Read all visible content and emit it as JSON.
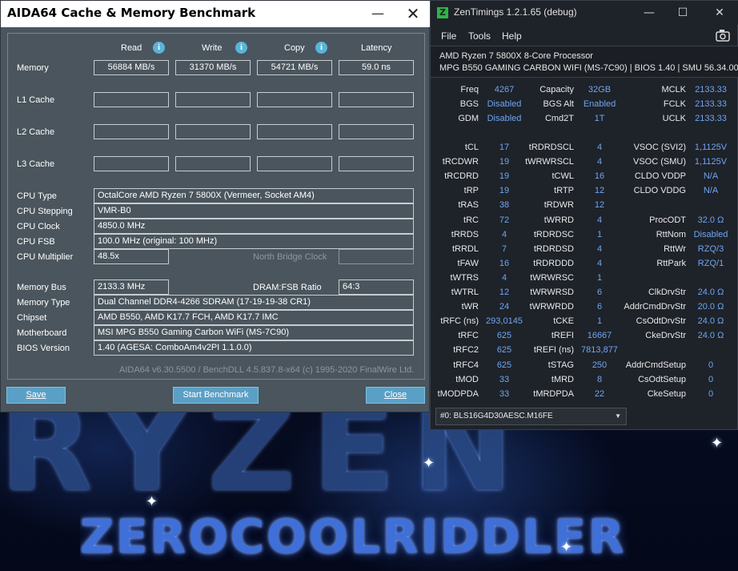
{
  "wallpaper": {
    "brand_text": "RYZEN",
    "signature_text": "ZEROCOOLRIDDLER"
  },
  "aida": {
    "title": "AIDA64 Cache & Memory Benchmark",
    "headers": {
      "read": "Read",
      "write": "Write",
      "copy": "Copy",
      "latency": "Latency"
    },
    "cache_rows": [
      {
        "label": "Memory",
        "read": "56884 MB/s",
        "write": "31370 MB/s",
        "copy": "54721 MB/s",
        "latency": "59.0 ns"
      },
      {
        "label": "L1 Cache",
        "read": "",
        "write": "",
        "copy": "",
        "latency": ""
      },
      {
        "label": "L2 Cache",
        "read": "",
        "write": "",
        "copy": "",
        "latency": ""
      },
      {
        "label": "L3 Cache",
        "read": "",
        "write": "",
        "copy": "",
        "latency": ""
      }
    ],
    "cpu": {
      "type_label": "CPU Type",
      "type": "OctalCore AMD Ryzen 7 5800X  (Vermeer, Socket AM4)",
      "stepping_label": "CPU Stepping",
      "stepping": "VMR-B0",
      "clock_label": "CPU Clock",
      "clock": "4850.0 MHz",
      "fsb_label": "CPU FSB",
      "fsb": "100.0 MHz  (original: 100 MHz)",
      "multiplier_label": "CPU Multiplier",
      "multiplier": "48.5x",
      "nb_clock_label": "North Bridge Clock",
      "nb_clock": ""
    },
    "system": {
      "memory_bus_label": "Memory Bus",
      "memory_bus": "2133.3 MHz",
      "dram_fsb_label": "DRAM:FSB Ratio",
      "dram_fsb": "64:3",
      "memory_type_label": "Memory Type",
      "memory_type": "Dual Channel DDR4-4266 SDRAM  (17-19-19-38 CR1)",
      "chipset_label": "Chipset",
      "chipset": "AMD B550, AMD K17.7 FCH, AMD K17.7 IMC",
      "motherboard_label": "Motherboard",
      "motherboard": "MSI MPG B550 Gaming Carbon WiFi (MS-7C90)",
      "bios_label": "BIOS Version",
      "bios": "1.40  (AGESA: ComboAm4v2PI 1.1.0.0)"
    },
    "footer": "AIDA64 v6.30.5500 / BenchDLL 4.5.837.8-x64  (c) 1995-2020 FinalWire Ltd.",
    "buttons": {
      "save": "Save",
      "start": "Start Benchmark",
      "close": "Close"
    }
  },
  "zen": {
    "title": "ZenTimings 1.2.1.65 (debug)",
    "menu": {
      "file": "File",
      "tools": "Tools",
      "help": "Help"
    },
    "cpu_name": "AMD Ryzen 7 5800X 8-Core Processor",
    "board": "MPG B550 GAMING CARBON WIFI (MS-7C90) | BIOS 1.40 | SMU 56.34.00",
    "top_rows": [
      [
        {
          "k": "Freq",
          "v": "4267"
        },
        {
          "k": "Capacity",
          "v": "32GB"
        },
        {
          "k": "MCLK",
          "v": "2133.33"
        }
      ],
      [
        {
          "k": "BGS",
          "v": "Disabled"
        },
        {
          "k": "BGS Alt",
          "v": "Enabled"
        },
        {
          "k": "FCLK",
          "v": "2133.33"
        }
      ],
      [
        {
          "k": "GDM",
          "v": "Disabled"
        },
        {
          "k": "Cmd2T",
          "v": "1T"
        },
        {
          "k": "UCLK",
          "v": "2133.33"
        }
      ]
    ],
    "rows": [
      [
        {
          "k": "tCL",
          "v": "17"
        },
        {
          "k": "tRDRDSCL",
          "v": "4"
        },
        {
          "k": "VSOC (SVI2)",
          "v": "1,1125V"
        }
      ],
      [
        {
          "k": "tRCDWR",
          "v": "19"
        },
        {
          "k": "tWRWRSCL",
          "v": "4"
        },
        {
          "k": "VSOC (SMU)",
          "v": "1,1125V"
        }
      ],
      [
        {
          "k": "tRCDRD",
          "v": "19"
        },
        {
          "k": "tCWL",
          "v": "16"
        },
        {
          "k": "CLDO VDDP",
          "v": "N/A"
        }
      ],
      [
        {
          "k": "tRP",
          "v": "19"
        },
        {
          "k": "tRTP",
          "v": "12"
        },
        {
          "k": "CLDO VDDG",
          "v": "N/A"
        }
      ],
      [
        {
          "k": "tRAS",
          "v": "38"
        },
        {
          "k": "tRDWR",
          "v": "12"
        },
        {
          "k": "",
          "v": ""
        }
      ],
      [
        {
          "k": "tRC",
          "v": "72"
        },
        {
          "k": "tWRRD",
          "v": "4"
        },
        {
          "k": "ProcODT",
          "v": "32.0 Ω"
        }
      ],
      [
        {
          "k": "tRRDS",
          "v": "4"
        },
        {
          "k": "tRDRDSC",
          "v": "1"
        },
        {
          "k": "RttNom",
          "v": "Disabled"
        }
      ],
      [
        {
          "k": "tRRDL",
          "v": "7"
        },
        {
          "k": "tRDRDSD",
          "v": "4"
        },
        {
          "k": "RttWr",
          "v": "RZQ/3"
        }
      ],
      [
        {
          "k": "tFAW",
          "v": "16"
        },
        {
          "k": "tRDRDDD",
          "v": "4"
        },
        {
          "k": "RttPark",
          "v": "RZQ/1"
        }
      ],
      [
        {
          "k": "tWTRS",
          "v": "4"
        },
        {
          "k": "tWRWRSC",
          "v": "1"
        },
        {
          "k": "",
          "v": ""
        }
      ],
      [
        {
          "k": "tWTRL",
          "v": "12"
        },
        {
          "k": "tWRWRSD",
          "v": "6"
        },
        {
          "k": "ClkDrvStr",
          "v": "24.0 Ω"
        }
      ],
      [
        {
          "k": "tWR",
          "v": "24"
        },
        {
          "k": "tWRWRDD",
          "v": "6"
        },
        {
          "k": "AddrCmdDrvStr",
          "v": "20.0 Ω"
        }
      ],
      [
        {
          "k": "tRFC (ns)",
          "v": "293,0145"
        },
        {
          "k": "tCKE",
          "v": "1"
        },
        {
          "k": "CsOdtDrvStr",
          "v": "24.0 Ω"
        }
      ],
      [
        {
          "k": "tRFC",
          "v": "625"
        },
        {
          "k": "tREFI",
          "v": "16667"
        },
        {
          "k": "CkeDrvStr",
          "v": "24.0 Ω"
        }
      ],
      [
        {
          "k": "tRFC2",
          "v": "625"
        },
        {
          "k": "tREFI (ns)",
          "v": "7813,877"
        },
        {
          "k": "",
          "v": ""
        }
      ],
      [
        {
          "k": "tRFC4",
          "v": "625"
        },
        {
          "k": "tSTAG",
          "v": "250"
        },
        {
          "k": "AddrCmdSetup",
          "v": "0"
        }
      ],
      [
        {
          "k": "tMOD",
          "v": "33"
        },
        {
          "k": "tMRD",
          "v": "8"
        },
        {
          "k": "CsOdtSetup",
          "v": "0"
        }
      ],
      [
        {
          "k": "tMODPDA",
          "v": "33"
        },
        {
          "k": "tMRDPDA",
          "v": "22"
        },
        {
          "k": "CkeSetup",
          "v": "0"
        }
      ]
    ],
    "dimm_selected": "#0: BLS16G4D30AESC.M16FE"
  }
}
